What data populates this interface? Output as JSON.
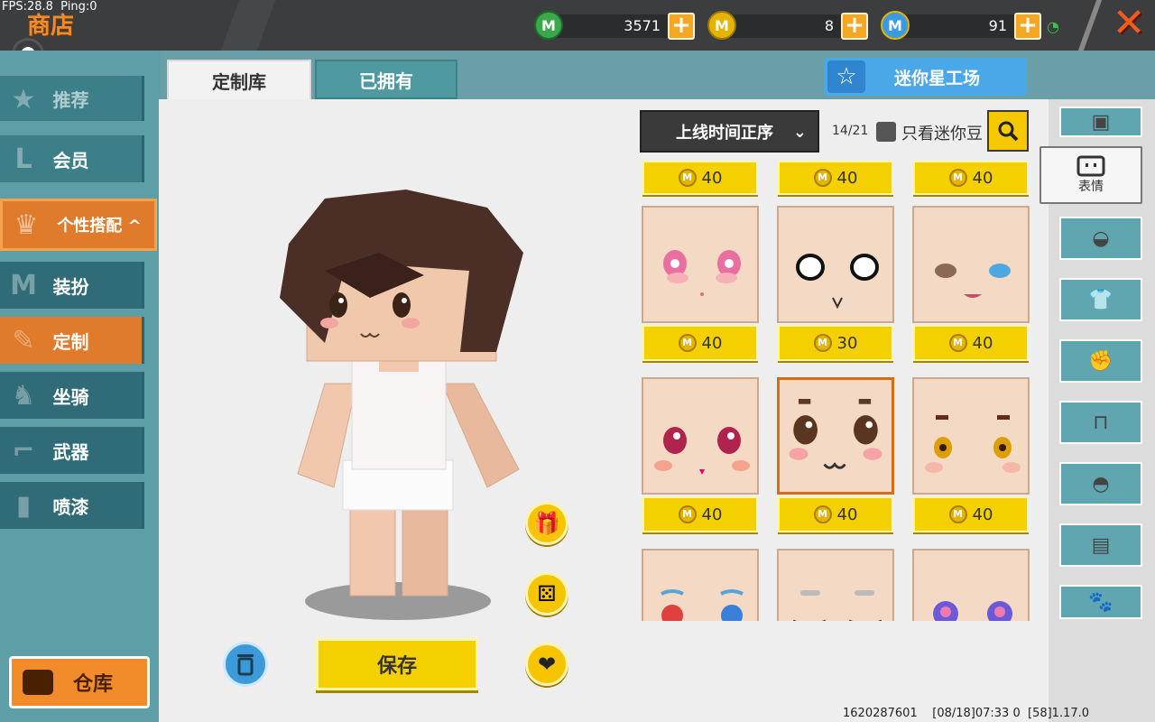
{
  "status": {
    "fps": "FPS:28.8",
    "ping": "Ping:0"
  },
  "header": {
    "title": "商店",
    "currencies": [
      {
        "icon": "green-gem-icon",
        "value": "3571",
        "color": "#3aa84a"
      },
      {
        "icon": "gold-coin-icon",
        "value": "8",
        "color": "#e6b400"
      },
      {
        "icon": "mini-bean-icon",
        "value": "91",
        "color": "#3b9be0"
      }
    ]
  },
  "sidebar": {
    "items": [
      {
        "label": "推荐",
        "icon": "star-icon"
      },
      {
        "label": "会员",
        "icon": "vip-icon"
      },
      {
        "label": "个性搭配 ^",
        "icon": "trophy-icon"
      },
      {
        "label": "装扮",
        "icon": "shirt-icon"
      },
      {
        "label": "定制",
        "icon": "pencil-icon"
      },
      {
        "label": "坐骑",
        "icon": "mount-icon"
      },
      {
        "label": "武器",
        "icon": "gun-icon"
      },
      {
        "label": "喷漆",
        "icon": "spray-can-icon"
      }
    ],
    "warehouse_label": "仓库"
  },
  "tabs": {
    "custom_library": "定制库",
    "owned": "已拥有"
  },
  "workshop_button": "迷你星工场",
  "filter": {
    "sort_label": "上线时间正序",
    "count": "14/21",
    "only_mini_bean_label": "只看迷你豆"
  },
  "actions": {
    "save_label": "保存"
  },
  "items": [
    {
      "price": "40"
    },
    {
      "price": "40"
    },
    {
      "price": "40"
    },
    {
      "price": "40"
    },
    {
      "price": "30"
    },
    {
      "price": "40"
    },
    {
      "price": "40"
    },
    {
      "price": "40"
    },
    {
      "price": "40"
    },
    {
      "price": ""
    },
    {
      "price": ""
    },
    {
      "price": ""
    }
  ],
  "categories": {
    "active_label": "表情",
    "icons": [
      "head-icon",
      "face-icon",
      "mask-icon",
      "shirt-icon",
      "gloves-icon",
      "pants-icon",
      "shoes-icon",
      "backpack-icon",
      "paw-icon"
    ]
  },
  "footer": {
    "user_id": "1620287601",
    "timestamp": "[08/18]07:33 0",
    "version": "[58]1.17.0"
  }
}
